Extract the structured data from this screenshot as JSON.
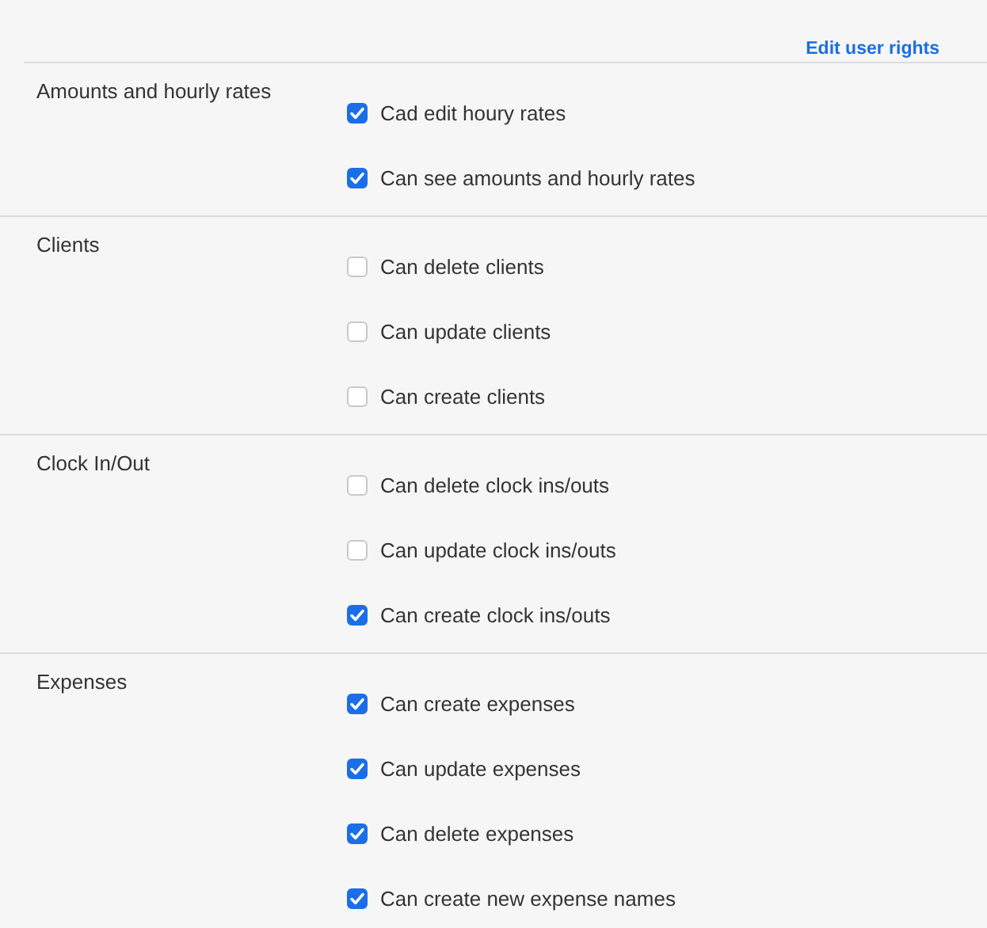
{
  "header": {
    "link": "Edit user rights"
  },
  "sections": [
    {
      "title": "Amounts and hourly rates",
      "permissions": [
        {
          "label": "Cad edit houry rates",
          "checked": true
        },
        {
          "label": "Can see amounts and hourly rates",
          "checked": true
        }
      ]
    },
    {
      "title": "Clients",
      "permissions": [
        {
          "label": "Can delete clients",
          "checked": false
        },
        {
          "label": "Can update clients",
          "checked": false
        },
        {
          "label": "Can create clients",
          "checked": false
        }
      ]
    },
    {
      "title": "Clock In/Out",
      "permissions": [
        {
          "label": "Can delete clock ins/outs",
          "checked": false
        },
        {
          "label": "Can update clock ins/outs",
          "checked": false
        },
        {
          "label": "Can create clock ins/outs",
          "checked": true
        }
      ]
    },
    {
      "title": "Expenses",
      "permissions": [
        {
          "label": "Can create expenses",
          "checked": true
        },
        {
          "label": "Can update expenses",
          "checked": true
        },
        {
          "label": "Can delete expenses",
          "checked": true
        },
        {
          "label": "Can create new expense names",
          "checked": true
        }
      ]
    }
  ]
}
